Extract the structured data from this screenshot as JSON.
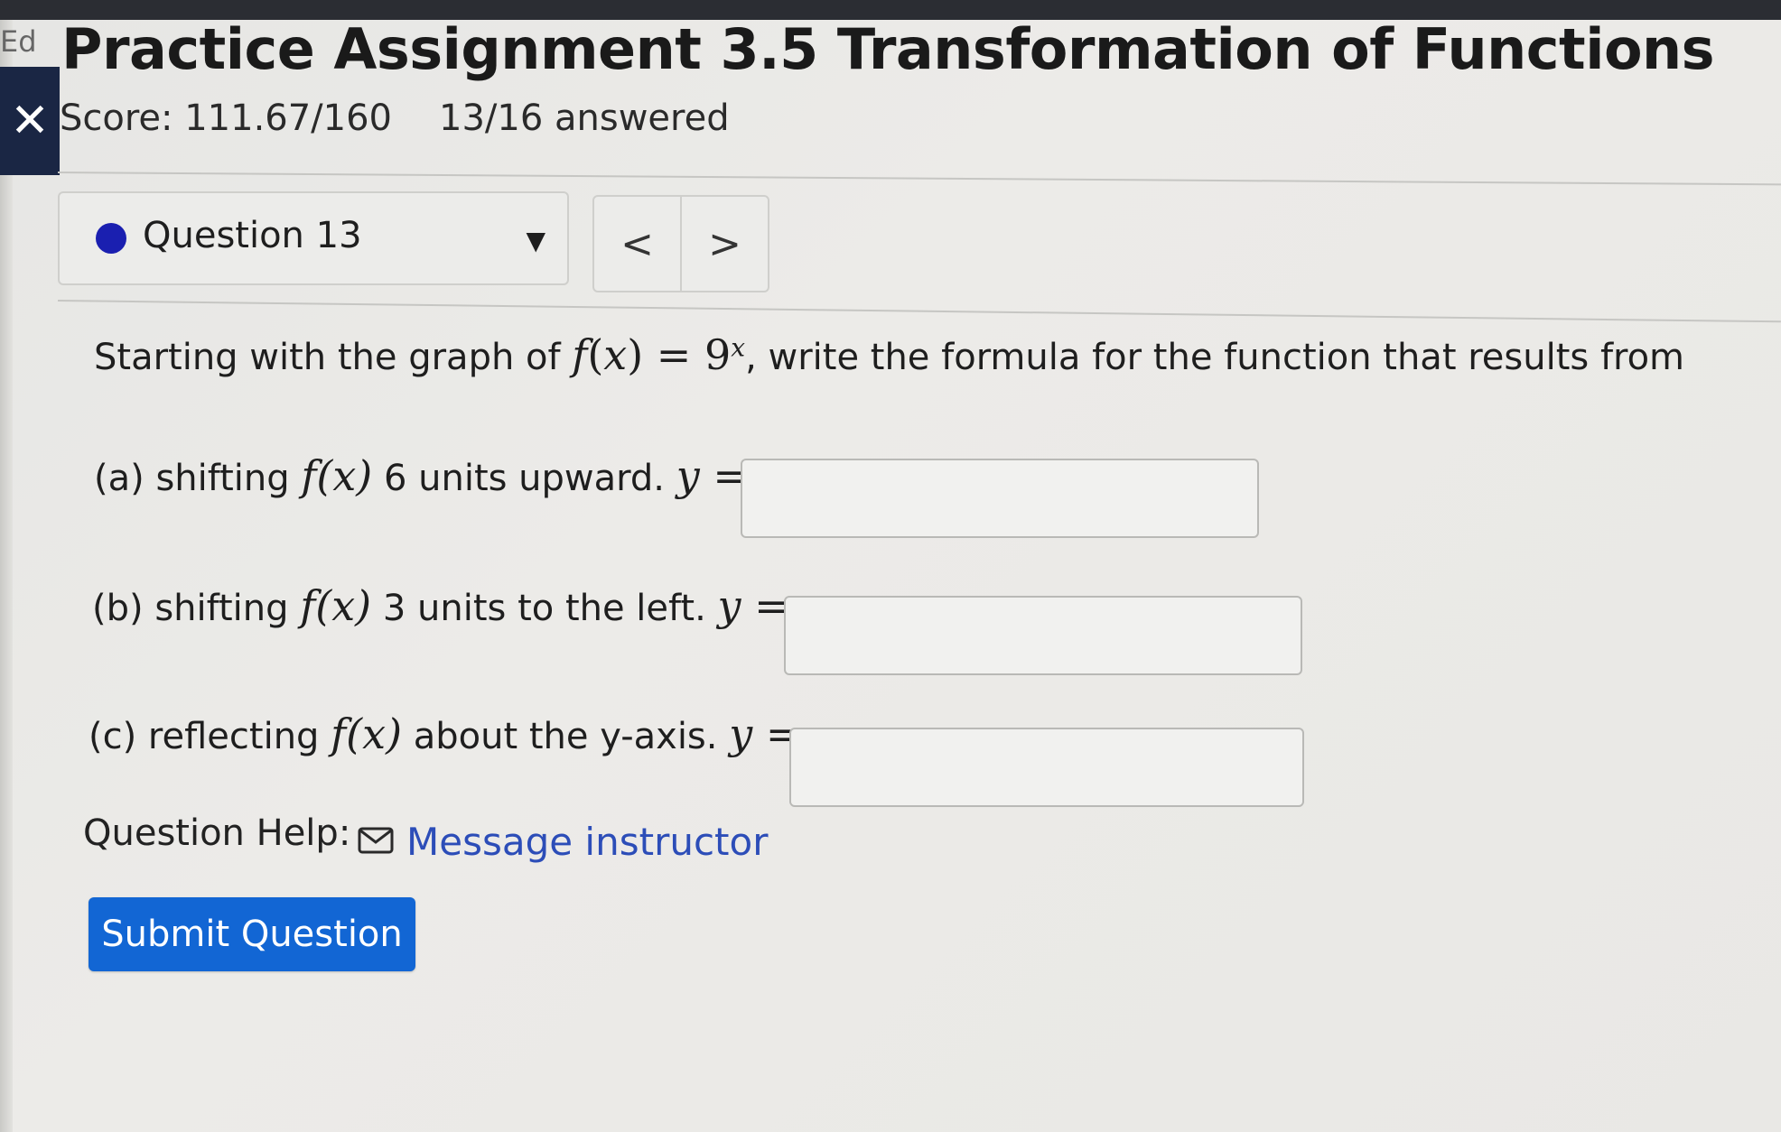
{
  "page": {
    "edge_text": "Ed",
    "title": "Practice Assignment 3.5 Transformation of Functions",
    "score": "Score: 111.67/160",
    "answered": "13/16 answered"
  },
  "question_nav": {
    "selected": "Question 13",
    "prev": "<",
    "next": ">"
  },
  "question": {
    "prompt_before": "Starting with the graph of ",
    "prompt_func": "f",
    "prompt_paren_open": "(",
    "prompt_var": "x",
    "prompt_paren_close": ")",
    "prompt_equals": " = ",
    "prompt_base": "9",
    "prompt_exp": "x",
    "prompt_after": ", write the formula for the function that results from",
    "parts": [
      {
        "label": "(a) shifting ",
        "after": " 6 units upward. "
      },
      {
        "label": "(b) shifting ",
        "after": " 3 units to the left. "
      },
      {
        "label": "(c) reflecting ",
        "after": " about the y-axis. "
      }
    ],
    "fx": "f(x)",
    "y_equals": "y ="
  },
  "help": {
    "label": "Question Help:",
    "link": "Message instructor"
  },
  "submit_label": "Submit Question",
  "colors": {
    "submit": "#1266d4",
    "link": "#2c4db8",
    "status_dot": "#1a1fb0",
    "close_tab": "#1a2644"
  }
}
